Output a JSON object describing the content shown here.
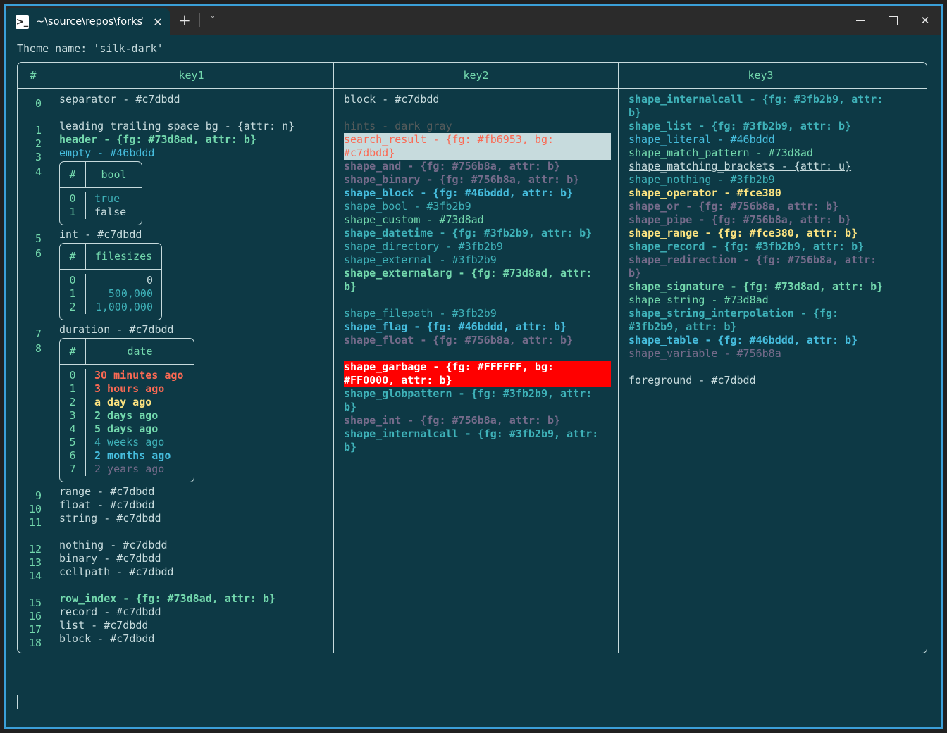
{
  "window": {
    "tab": {
      "icon": "powershell-icon",
      "title": "~\\source\\repos\\forks\\nu_scrip",
      "close_label": "✕"
    },
    "new_tab_label": "+",
    "dropdown_label": "˅",
    "controls": {
      "minimize": "─",
      "maximize": "□",
      "close": "✕"
    },
    "accent_border": "#3b9fd8",
    "background": "#0d3945"
  },
  "terminal": {
    "theme_line": "Theme name: 'silk-dark'",
    "cursor_visible": true
  },
  "table": {
    "headers": {
      "index": "#",
      "key1": "key1",
      "key2": "key2",
      "key3": "key3"
    },
    "row_indices": [
      "0",
      "1",
      "2",
      "3",
      "4",
      "5",
      "6",
      "7",
      "8",
      "9",
      "10",
      "11",
      "12",
      "13",
      "14",
      "15",
      "16",
      "17",
      "18"
    ],
    "key1": [
      {
        "text": "separator - #c7dbdd",
        "style": "c-fg"
      },
      {
        "text": "",
        "style": "blank"
      },
      {
        "text": "leading_trailing_space_bg - {attr: n}",
        "style": "c-fg"
      },
      {
        "text": "header - {fg: #73d8ad, attr: b}",
        "style": "c-green b"
      },
      {
        "text": "empty - #46bddd",
        "style": "c-bcyan"
      },
      {
        "nested": "bool"
      },
      {
        "text": "int - #c7dbdd",
        "style": "c-fg"
      },
      {
        "nested": "filesizes"
      },
      {
        "text": "duration - #c7dbdd",
        "style": "c-fg"
      },
      {
        "nested": "date"
      },
      {
        "text": "range - #c7dbdd",
        "style": "c-fg"
      },
      {
        "text": "float - #c7dbdd",
        "style": "c-fg"
      },
      {
        "text": "string - #c7dbdd",
        "style": "c-fg"
      },
      {
        "text": "",
        "style": "blank"
      },
      {
        "text": "nothing - #c7dbdd",
        "style": "c-fg"
      },
      {
        "text": "binary - #c7dbdd",
        "style": "c-fg"
      },
      {
        "text": "cellpath - #c7dbdd",
        "style": "c-fg"
      },
      {
        "text": "",
        "style": "blank"
      },
      {
        "text": "row_index - {fg: #73d8ad, attr: b}",
        "style": "c-green b"
      },
      {
        "text": "record - #c7dbdd",
        "style": "c-fg"
      },
      {
        "text": "list - #c7dbdd",
        "style": "c-fg"
      },
      {
        "text": "block - #c7dbdd",
        "style": "c-fg"
      }
    ],
    "key2": [
      {
        "text": "block - #c7dbdd",
        "style": "c-fg"
      },
      {
        "text": "",
        "style": "blank"
      },
      {
        "text": "hints - dark_gray",
        "style": "c-dgray"
      },
      {
        "text": "search_result - {fg: #fb6953, bg: #c7dbdd}",
        "style": "hl-search"
      },
      {
        "text": "shape_and - {fg: #756b8a, attr: b}",
        "style": "c-gray b"
      },
      {
        "text": "shape_binary - {fg: #756b8a, attr: b}",
        "style": "c-gray b"
      },
      {
        "text": "shape_block - {fg: #46bddd, attr: b}",
        "style": "c-bcyan b"
      },
      {
        "text": "shape_bool - #3fb2b9",
        "style": "c-cyan"
      },
      {
        "text": "shape_custom - #73d8ad",
        "style": "c-green"
      },
      {
        "text": "shape_datetime - {fg: #3fb2b9, attr: b}",
        "style": "c-cyan b"
      },
      {
        "text": "shape_directory - #3fb2b9",
        "style": "c-cyan"
      },
      {
        "text": "shape_external - #3fb2b9",
        "style": "c-cyan"
      },
      {
        "text": "shape_externalarg - {fg: #73d8ad, attr: b}",
        "style": "c-green b"
      },
      {
        "text": "",
        "style": "blank"
      },
      {
        "text": "shape_filepath - #3fb2b9",
        "style": "c-cyan"
      },
      {
        "text": "shape_flag - {fg: #46bddd, attr: b}",
        "style": "c-bcyan b"
      },
      {
        "text": "shape_float - {fg: #756b8a, attr: b}",
        "style": "c-gray b"
      },
      {
        "text": "",
        "style": "blank"
      },
      {
        "text": "shape_garbage - {fg: #FFFFFF, bg: #FF0000, attr: b}",
        "style": "hl-garbage"
      },
      {
        "text": "shape_globpattern - {fg: #3fb2b9, attr: b}",
        "style": "c-cyan b"
      },
      {
        "text": "shape_int - {fg: #756b8a, attr: b}",
        "style": "c-gray b"
      },
      {
        "text": "shape_internalcall - {fg: #3fb2b9, attr: b}",
        "style": "c-cyan b"
      }
    ],
    "key3": [
      {
        "text": "shape_internalcall - {fg: #3fb2b9, attr: b}",
        "style": "c-cyan b"
      },
      {
        "text": "shape_list - {fg: #3fb2b9, attr: b}",
        "style": "c-cyan b"
      },
      {
        "text": "shape_literal - #46bddd",
        "style": "c-bcyan"
      },
      {
        "text": "shape_match_pattern - #73d8ad",
        "style": "c-green"
      },
      {
        "text": "shape_matching_brackets - {attr: u}",
        "style": "c-fg u"
      },
      {
        "text": "shape_nothing - #3fb2b9",
        "style": "c-cyan"
      },
      {
        "text": "shape_operator - #fce380",
        "style": "c-yellow b"
      },
      {
        "text": "shape_or - {fg: #756b8a, attr: b}",
        "style": "c-gray b"
      },
      {
        "text": "shape_pipe - {fg: #756b8a, attr: b}",
        "style": "c-gray b"
      },
      {
        "text": "shape_range - {fg: #fce380, attr: b}",
        "style": "c-yellow b"
      },
      {
        "text": "shape_record - {fg: #3fb2b9, attr: b}",
        "style": "c-cyan b"
      },
      {
        "text": "shape_redirection - {fg: #756b8a, attr: b}",
        "style": "c-gray b"
      },
      {
        "text": "shape_signature - {fg: #73d8ad, attr: b}",
        "style": "c-green b"
      },
      {
        "text": "shape_string - #73d8ad",
        "style": "c-green"
      },
      {
        "text": "shape_string_interpolation - {fg: #3fb2b9, attr: b}",
        "style": "c-cyan b"
      },
      {
        "text": "shape_table - {fg: #46bddd, attr: b}",
        "style": "c-bcyan b"
      },
      {
        "text": "shape_variable - #756b8a",
        "style": "c-gray"
      },
      {
        "text": "",
        "style": "blank"
      },
      {
        "text": "foreground - #c7dbdd",
        "style": "c-fg"
      }
    ]
  },
  "nested_tables": {
    "bool": {
      "headers": [
        "#",
        "bool"
      ],
      "rows": [
        {
          "index": "0",
          "value": "true",
          "style": "c-cyan"
        },
        {
          "index": "1",
          "value": "false",
          "style": "c-fg"
        }
      ]
    },
    "filesizes": {
      "headers": [
        "#",
        "filesizes"
      ],
      "rows": [
        {
          "index": "0",
          "value": "0",
          "style": "c-fg"
        },
        {
          "index": "1",
          "value": "500,000",
          "style": "c-cyan"
        },
        {
          "index": "2",
          "value": "1,000,000",
          "style": "c-cyan"
        }
      ]
    },
    "date": {
      "headers": [
        "#",
        "date"
      ],
      "rows": [
        {
          "index": "0",
          "value": "30 minutes ago",
          "style": "c-red b"
        },
        {
          "index": "1",
          "value": "3 hours ago",
          "style": "c-red b"
        },
        {
          "index": "2",
          "value": "a day ago",
          "style": "c-yellow b"
        },
        {
          "index": "3",
          "value": "2 days ago",
          "style": "c-green b"
        },
        {
          "index": "4",
          "value": "5 days ago",
          "style": "c-green b"
        },
        {
          "index": "5",
          "value": "4 weeks ago",
          "style": "c-cyan"
        },
        {
          "index": "6",
          "value": "2 months ago",
          "style": "c-bcyan b"
        },
        {
          "index": "7",
          "value": "2 years ago",
          "style": "c-gray"
        }
      ]
    }
  }
}
